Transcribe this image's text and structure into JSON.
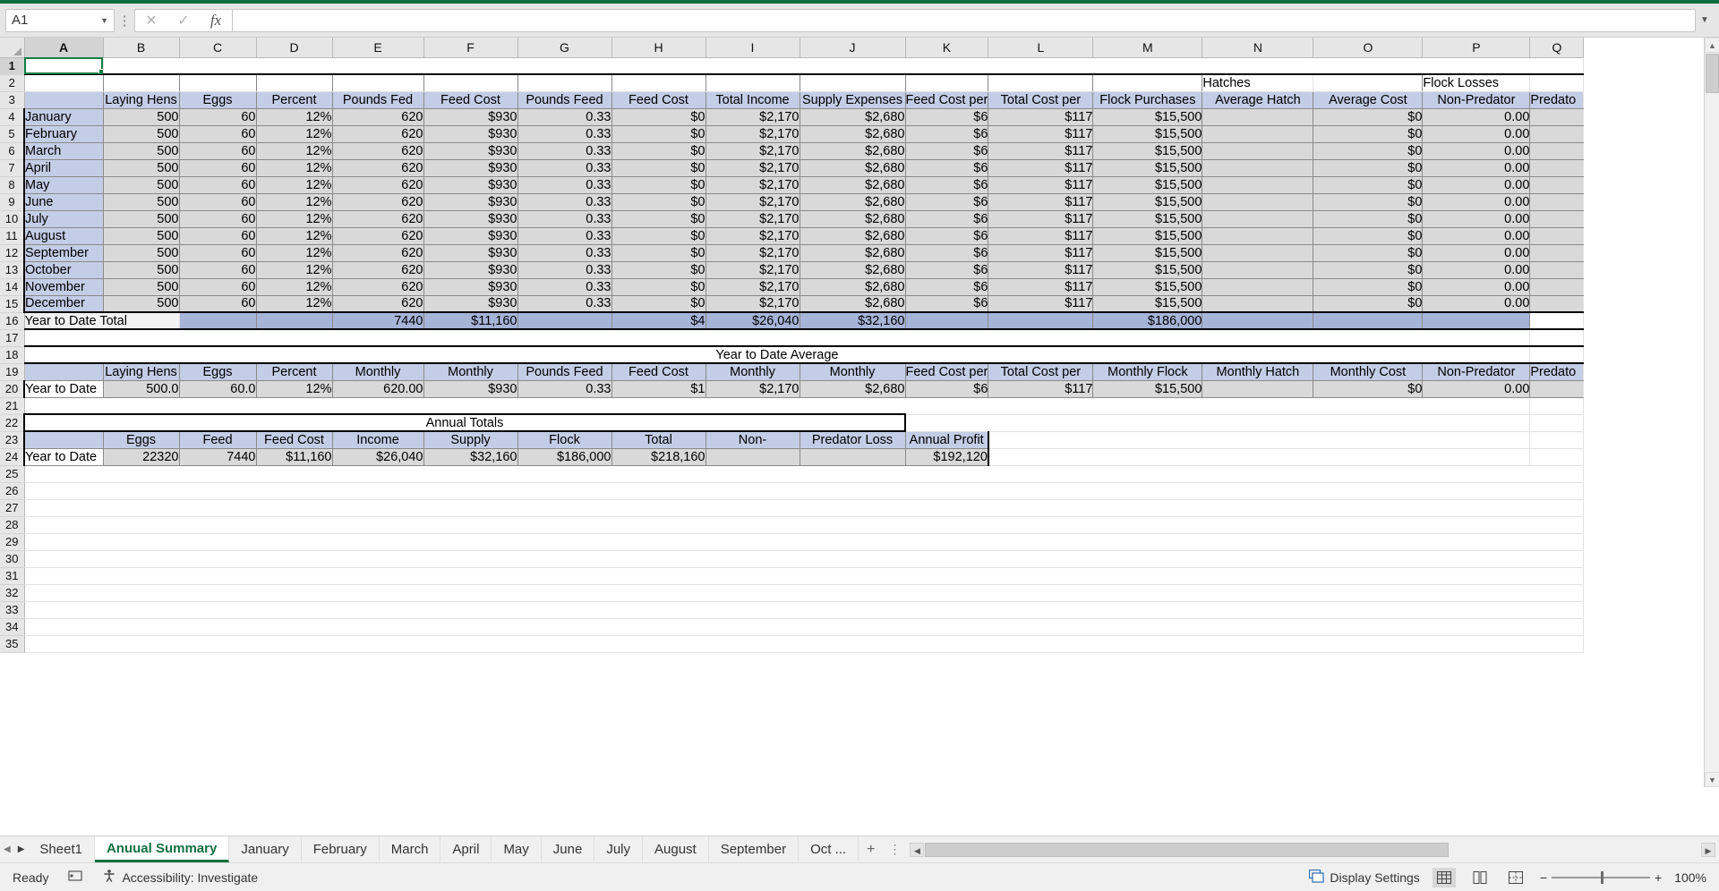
{
  "app": {
    "name_box_value": "A1",
    "formula_value": "",
    "cancel_icon": "close-icon",
    "confirm_icon": "check-icon",
    "function_icon": "fx-icon"
  },
  "columns": [
    "A",
    "B",
    "C",
    "D",
    "E",
    "F",
    "G",
    "H",
    "I",
    "J",
    "K",
    "L",
    "M",
    "N",
    "O",
    "P",
    "Q"
  ],
  "row_numbers": [
    1,
    2,
    3,
    4,
    5,
    6,
    7,
    8,
    9,
    10,
    11,
    12,
    13,
    14,
    15,
    16,
    17,
    18,
    19,
    20,
    21,
    22,
    23,
    24,
    25,
    26,
    27,
    28,
    29,
    30,
    31,
    32,
    33,
    34,
    35
  ],
  "group_titles": {
    "hatches": "Hatches",
    "flock_losses": "Flock Losses"
  },
  "monthly_table": {
    "headers": [
      "",
      "Laying Hens",
      "Eggs",
      "Percent",
      "Pounds Fed",
      "Feed Cost",
      "Pounds Feed",
      "Feed Cost",
      "Total Income",
      "Supply Expenses",
      "Feed Cost per",
      "Total Cost per",
      "Flock Purchases",
      "Average Hatch",
      "Average Cost",
      "Non-Predator",
      "Predato"
    ],
    "rows": [
      {
        "label": "January",
        "values": [
          "500",
          "60",
          "12%",
          "620",
          "$930",
          "0.33",
          "$0",
          "$2,170",
          "$2,680",
          "$6",
          "$117",
          "$15,500",
          "",
          "$0",
          "0.00",
          ""
        ]
      },
      {
        "label": "February",
        "values": [
          "500",
          "60",
          "12%",
          "620",
          "$930",
          "0.33",
          "$0",
          "$2,170",
          "$2,680",
          "$6",
          "$117",
          "$15,500",
          "",
          "$0",
          "0.00",
          ""
        ]
      },
      {
        "label": "March",
        "values": [
          "500",
          "60",
          "12%",
          "620",
          "$930",
          "0.33",
          "$0",
          "$2,170",
          "$2,680",
          "$6",
          "$117",
          "$15,500",
          "",
          "$0",
          "0.00",
          ""
        ]
      },
      {
        "label": "April",
        "values": [
          "500",
          "60",
          "12%",
          "620",
          "$930",
          "0.33",
          "$0",
          "$2,170",
          "$2,680",
          "$6",
          "$117",
          "$15,500",
          "",
          "$0",
          "0.00",
          ""
        ]
      },
      {
        "label": "May",
        "values": [
          "500",
          "60",
          "12%",
          "620",
          "$930",
          "0.33",
          "$0",
          "$2,170",
          "$2,680",
          "$6",
          "$117",
          "$15,500",
          "",
          "$0",
          "0.00",
          ""
        ]
      },
      {
        "label": "June",
        "values": [
          "500",
          "60",
          "12%",
          "620",
          "$930",
          "0.33",
          "$0",
          "$2,170",
          "$2,680",
          "$6",
          "$117",
          "$15,500",
          "",
          "$0",
          "0.00",
          ""
        ]
      },
      {
        "label": "July",
        "values": [
          "500",
          "60",
          "12%",
          "620",
          "$930",
          "0.33",
          "$0",
          "$2,170",
          "$2,680",
          "$6",
          "$117",
          "$15,500",
          "",
          "$0",
          "0.00",
          ""
        ]
      },
      {
        "label": "August",
        "values": [
          "500",
          "60",
          "12%",
          "620",
          "$930",
          "0.33",
          "$0",
          "$2,170",
          "$2,680",
          "$6",
          "$117",
          "$15,500",
          "",
          "$0",
          "0.00",
          ""
        ]
      },
      {
        "label": "September",
        "values": [
          "500",
          "60",
          "12%",
          "620",
          "$930",
          "0.33",
          "$0",
          "$2,170",
          "$2,680",
          "$6",
          "$117",
          "$15,500",
          "",
          "$0",
          "0.00",
          ""
        ]
      },
      {
        "label": "October",
        "values": [
          "500",
          "60",
          "12%",
          "620",
          "$930",
          "0.33",
          "$0",
          "$2,170",
          "$2,680",
          "$6",
          "$117",
          "$15,500",
          "",
          "$0",
          "0.00",
          ""
        ]
      },
      {
        "label": "November",
        "values": [
          "500",
          "60",
          "12%",
          "620",
          "$930",
          "0.33",
          "$0",
          "$2,170",
          "$2,680",
          "$6",
          "$117",
          "$15,500",
          "",
          "$0",
          "0.00",
          ""
        ]
      },
      {
        "label": "December",
        "values": [
          "500",
          "60",
          "12%",
          "620",
          "$930",
          "0.33",
          "$0",
          "$2,170",
          "$2,680",
          "$6",
          "$117",
          "$15,500",
          "",
          "$0",
          "0.00",
          ""
        ]
      }
    ],
    "total_row": {
      "label": "Year to Date Total",
      "values": [
        "",
        "",
        "7440",
        "$11,160",
        "",
        "$4",
        "$26,040",
        "$32,160",
        "",
        "",
        "$186,000",
        "",
        "",
        "",
        ""
      ]
    }
  },
  "ytd_average": {
    "title": "Year to Date Average",
    "headers": [
      "",
      "Laying Hens",
      "Eggs",
      "Percent",
      "Monthly",
      "Monthly",
      "Pounds Feed",
      "Feed Cost",
      "Monthly",
      "Monthly",
      "Feed Cost per",
      "Total Cost per",
      "Monthly Flock",
      "Monthly  Hatch",
      "Monthly Cost",
      "Non-Predator",
      "Predato"
    ],
    "row": {
      "label": "Year to Date",
      "values": [
        "500.0",
        "60.0",
        "12%",
        "620.00",
        "$930",
        "0.33",
        "$1",
        "$2,170",
        "$2,680",
        "$6",
        "$117",
        "$15,500",
        "",
        "$0",
        "0.00",
        ""
      ]
    }
  },
  "annual_totals": {
    "title": "Annual Totals",
    "headers": [
      "",
      "Eggs",
      "Feed",
      "Feed Cost",
      "Income",
      "Supply",
      "Flock",
      "Total",
      "Non-",
      "Predator Loss",
      "Annual Profit"
    ],
    "row": {
      "label": "Year to Date",
      "values": [
        "22320",
        "7440",
        "$11,160",
        "$26,040",
        "$32,160",
        "$186,000",
        "$218,160",
        "",
        "",
        "$192,120"
      ]
    },
    "profit_color": "#ff0000"
  },
  "sheet_tabs": {
    "first_icon": "first-sheet-icon",
    "prev_icon": "prev-sheet-icon",
    "tabs": [
      {
        "label": "Sheet1",
        "active": false
      },
      {
        "label": "Anuual Summary",
        "active": true
      },
      {
        "label": "January",
        "active": false
      },
      {
        "label": "February",
        "active": false
      },
      {
        "label": "March",
        "active": false
      },
      {
        "label": "April",
        "active": false
      },
      {
        "label": "May",
        "active": false
      },
      {
        "label": "June",
        "active": false
      },
      {
        "label": "July",
        "active": false
      },
      {
        "label": "August",
        "active": false
      },
      {
        "label": "September",
        "active": false
      },
      {
        "label": "Oct ...",
        "active": false
      }
    ],
    "add_sheet_label": "+",
    "overflow_label": "⋮"
  },
  "status_bar": {
    "ready_label": "Ready",
    "macro_icon": "record-macro-icon",
    "accessibility_icon": "accessibility-icon",
    "accessibility_label": "Accessibility: Investigate",
    "display_settings_label": "Display Settings",
    "display_settings_icon": "display-settings-icon",
    "view_normal_icon": "normal-view-icon",
    "view_pagelayout_icon": "page-layout-view-icon",
    "view_pagebreak_icon": "page-break-view-icon",
    "zoom_out_label": "−",
    "zoom_in_label": "+",
    "zoom_level": "100%"
  },
  "colors": {
    "header_fill": "#c3cde6",
    "data_fill": "#d9d9d9",
    "total_fill": "#a6b4d8",
    "excel_green": "#127040",
    "profit_red": "#ff0000"
  }
}
